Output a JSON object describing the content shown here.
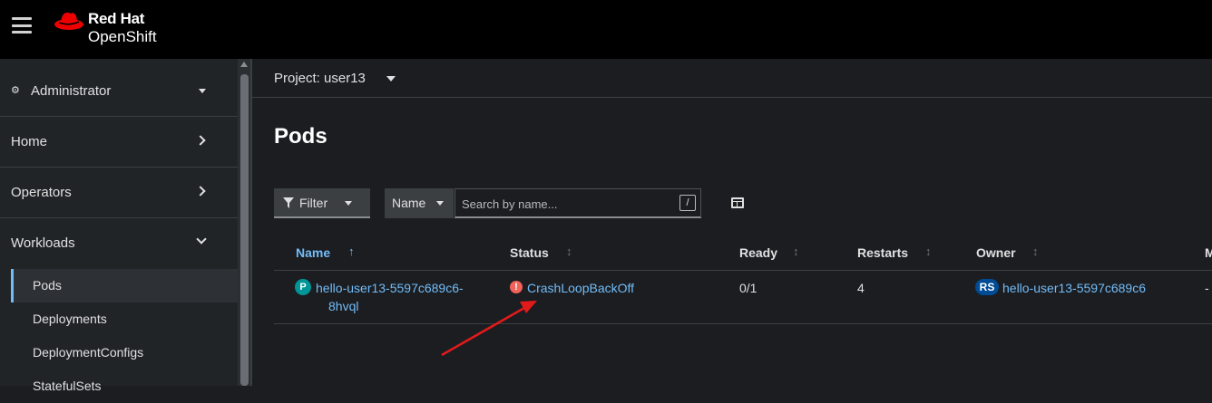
{
  "masthead": {
    "brand_line1": "Red Hat",
    "brand_line2": "OpenShift"
  },
  "sidebar": {
    "perspective": "Administrator",
    "sections": [
      {
        "label": "Home",
        "expanded": false
      },
      {
        "label": "Operators",
        "expanded": false
      },
      {
        "label": "Workloads",
        "expanded": true
      }
    ],
    "workloads_items": [
      {
        "label": "Pods",
        "active": true
      },
      {
        "label": "Deployments",
        "active": false
      },
      {
        "label": "DeploymentConfigs",
        "active": false
      },
      {
        "label": "StatefulSets",
        "active": false
      }
    ]
  },
  "project": {
    "label": "Project: user13"
  },
  "page": {
    "title": "Pods"
  },
  "toolbar": {
    "filter_label": "Filter",
    "name_select": "Name",
    "search_placeholder": "Search by name...",
    "shortcut": "/"
  },
  "table": {
    "columns": [
      "Name",
      "Status",
      "Ready",
      "Restarts",
      "Owner",
      "M"
    ],
    "rows": [
      {
        "kind_badge": "P",
        "name_line1": "hello-user13-5597c689c6-",
        "name_line2": "8hvql",
        "status": "CrashLoopBackOff",
        "ready": "0/1",
        "restarts": "4",
        "owner_badge": "RS",
        "owner": "hello-user13-5597c689c6",
        "memory": "-"
      }
    ]
  },
  "colors": {
    "masthead_bg": "#000000",
    "page_bg": "#1b1d21",
    "link": "#73bcf7",
    "error": "#f0625a",
    "annotation_arrow": "#e21a1a"
  }
}
